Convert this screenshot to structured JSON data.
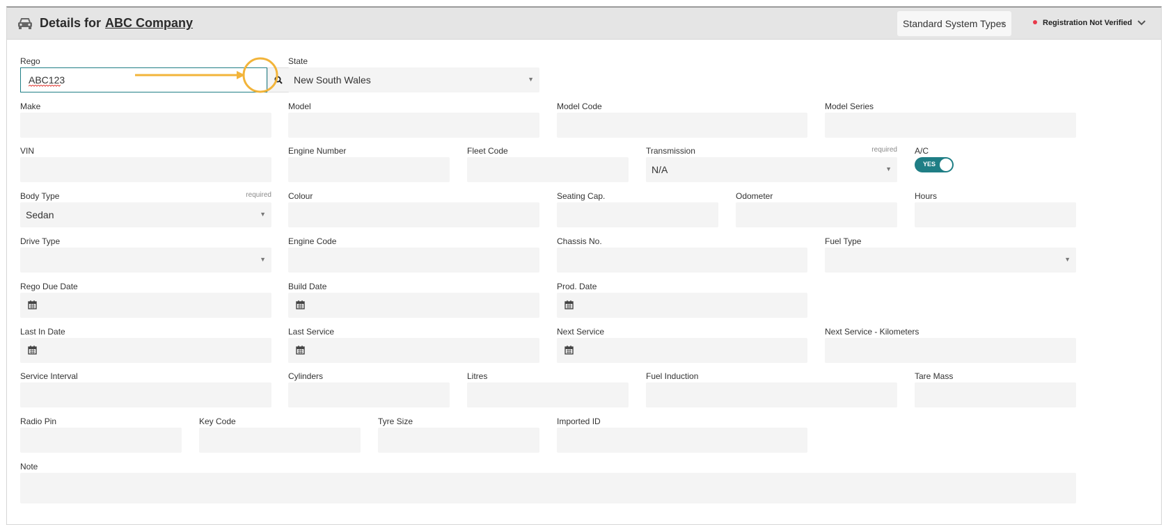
{
  "header": {
    "title_prefix": "Details for",
    "company": "ABC Company",
    "system_types": "Standard System Types",
    "registration_status": "Registration Not Verified",
    "status_color": "#e8394a"
  },
  "icons": {
    "car": "car-icon",
    "search": "search-icon",
    "calendar": "calendar-icon",
    "collapse": "chevron-down-icon",
    "caret": "▼"
  },
  "colors": {
    "accent": "#1f7e85",
    "annotation": "#f2b43a",
    "field_bg": "#f4f4f4"
  },
  "form": {
    "rego": {
      "label": "Rego",
      "value": "ABC123"
    },
    "state": {
      "label": "State",
      "value": "New South Wales"
    },
    "make": {
      "label": "Make"
    },
    "model": {
      "label": "Model"
    },
    "model_code": {
      "label": "Model Code"
    },
    "model_series": {
      "label": "Model Series"
    },
    "vin": {
      "label": "VIN"
    },
    "engine_number": {
      "label": "Engine Number"
    },
    "fleet_code": {
      "label": "Fleet Code"
    },
    "transmission": {
      "label": "Transmission",
      "required": "required",
      "value": "N/A"
    },
    "ac": {
      "label": "A/C",
      "toggle": "YES"
    },
    "body_type": {
      "label": "Body Type",
      "required": "required",
      "value": "Sedan"
    },
    "colour": {
      "label": "Colour"
    },
    "seating": {
      "label": "Seating Cap."
    },
    "odometer": {
      "label": "Odometer"
    },
    "hours": {
      "label": "Hours"
    },
    "drive_type": {
      "label": "Drive Type",
      "value": ""
    },
    "engine_code": {
      "label": "Engine Code"
    },
    "chassis": {
      "label": "Chassis No."
    },
    "fuel_type": {
      "label": "Fuel Type",
      "value": ""
    },
    "rego_due": {
      "label": "Rego Due Date"
    },
    "build_date": {
      "label": "Build Date"
    },
    "prod_date": {
      "label": "Prod. Date"
    },
    "last_in": {
      "label": "Last In Date"
    },
    "last_service": {
      "label": "Last Service"
    },
    "next_service": {
      "label": "Next Service"
    },
    "next_service_km": {
      "label": "Next Service - Kilometers"
    },
    "service_interval": {
      "label": "Service Interval"
    },
    "cylinders": {
      "label": "Cylinders"
    },
    "litres": {
      "label": "Litres"
    },
    "fuel_induction": {
      "label": "Fuel Induction"
    },
    "tare_mass": {
      "label": "Tare Mass"
    },
    "radio_pin": {
      "label": "Radio Pin"
    },
    "key_code": {
      "label": "Key Code"
    },
    "tyre_size": {
      "label": "Tyre Size"
    },
    "imported_id": {
      "label": "Imported ID"
    },
    "note": {
      "label": "Note"
    }
  }
}
